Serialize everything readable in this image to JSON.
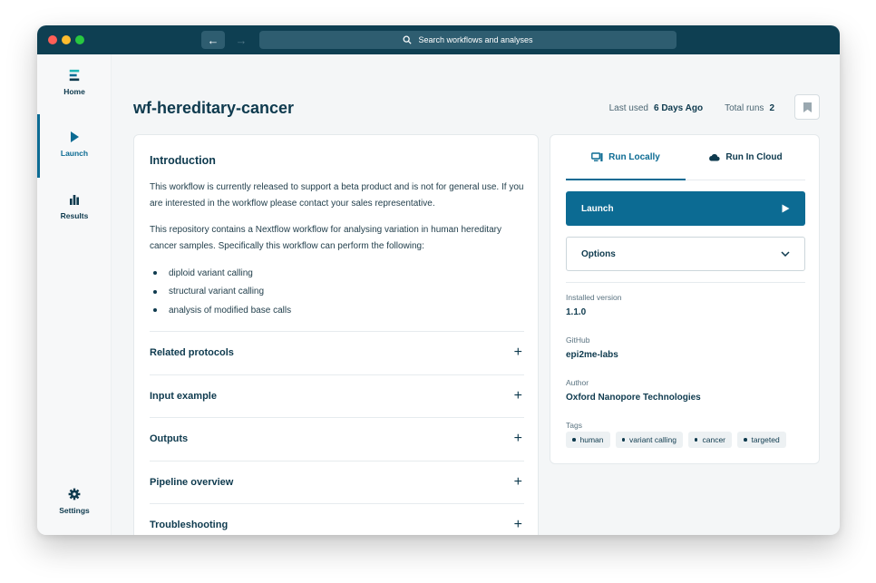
{
  "search": {
    "placeholder": "Search workflows and analyses"
  },
  "sidebar": {
    "items": [
      {
        "label": "Home",
        "icon": "home-icon"
      },
      {
        "label": "Launch",
        "icon": "play-icon"
      },
      {
        "label": "Results",
        "icon": "bar-chart-icon"
      }
    ],
    "settings_label": "Settings"
  },
  "header": {
    "title": "wf-hereditary-cancer",
    "last_used_label": "Last used",
    "last_used_value": "6 Days Ago",
    "total_runs_label": "Total runs",
    "total_runs_value": "2"
  },
  "intro": {
    "heading": "Introduction",
    "p1": "This workflow is currently released to support a beta product and is not for general use. If you are interested in the workflow please contact your sales representative.",
    "p2": "This repository contains a Nextflow workflow for analysing variation in human hereditary cancer samples. Specifically this workflow can perform the following:",
    "bullets": [
      "diploid variant calling",
      "structural variant calling",
      "analysis of modified base calls"
    ]
  },
  "sections": [
    "Related protocols",
    "Input example",
    "Outputs",
    "Pipeline overview",
    "Troubleshooting"
  ],
  "run_panel": {
    "tab_local": "Run Locally",
    "tab_cloud": "Run In Cloud",
    "launch_label": "Launch",
    "options_label": "Options",
    "installed_version_label": "Installed version",
    "installed_version": "1.1.0",
    "github_label": "GitHub",
    "github": "epi2me-labs",
    "author_label": "Author",
    "author": "Oxford Nanopore Technologies",
    "tags_label": "Tags",
    "tags": [
      "human",
      "variant calling",
      "cancer",
      "targeted"
    ]
  },
  "colors": {
    "titlebar": "#0e3f52",
    "accent": "#0c6b93",
    "text": "#0e3a4e"
  }
}
